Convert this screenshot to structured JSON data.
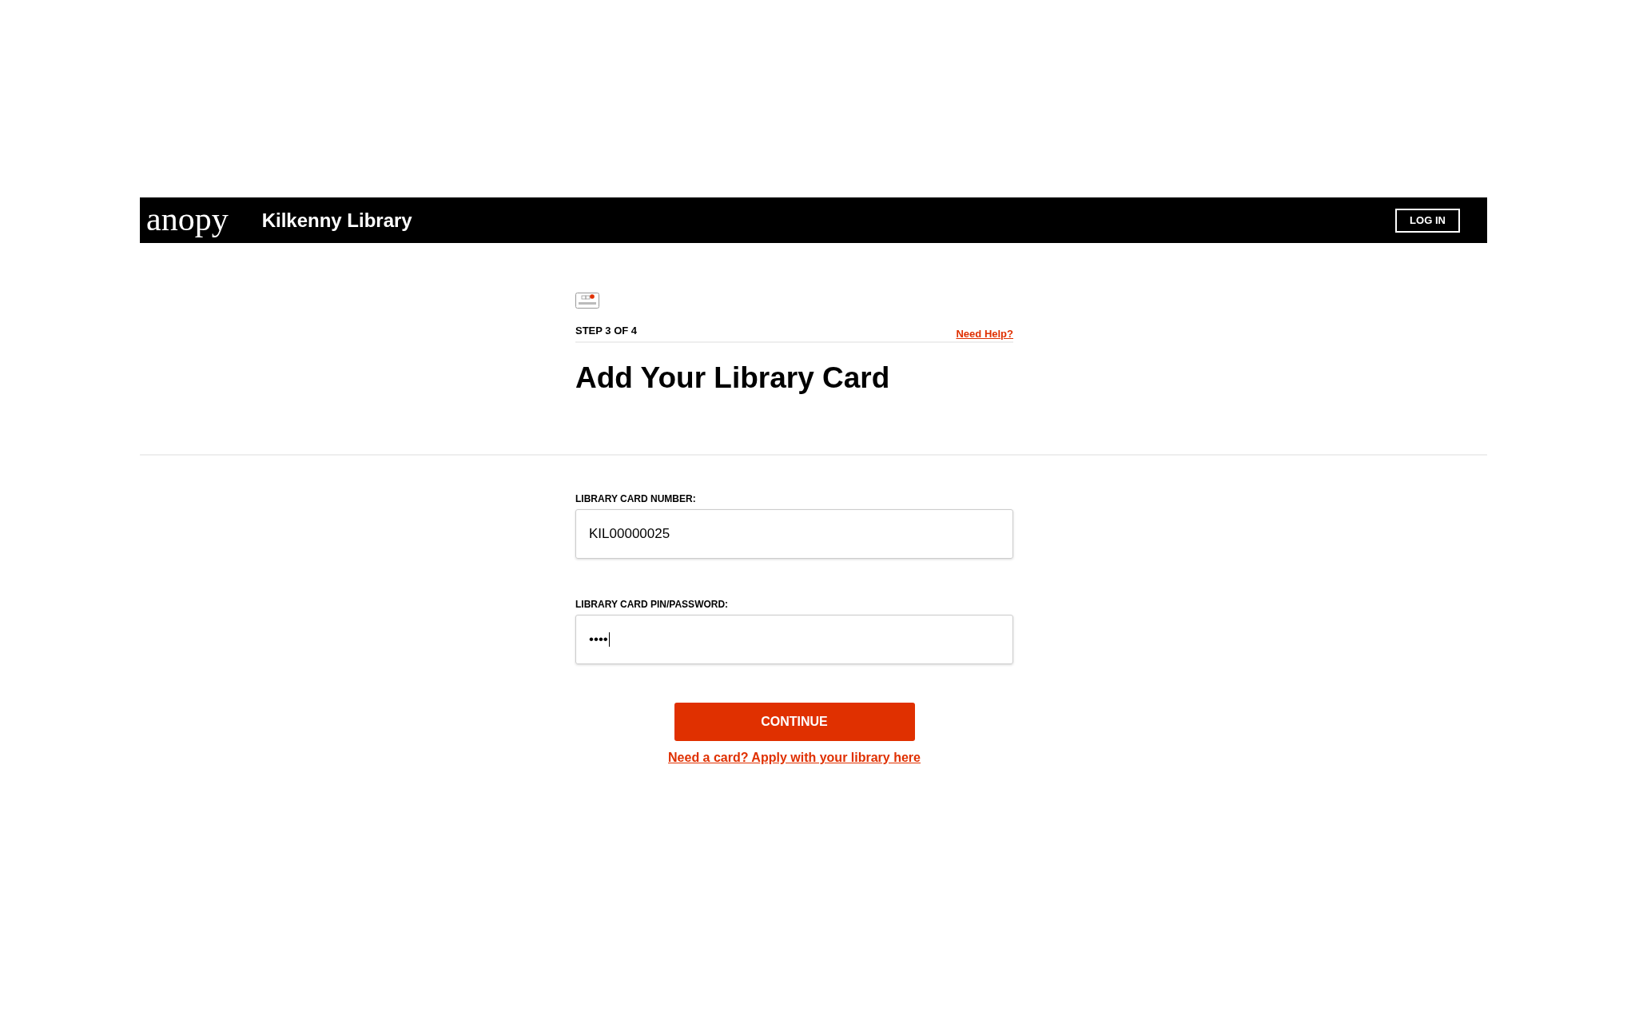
{
  "header": {
    "logo": "anopy",
    "library_name": "Kilkenny Library",
    "login_button": "LOG IN"
  },
  "step": {
    "label": "STEP 3 OF 4",
    "help_link": "Need Help?",
    "title": "Add Your Library Card"
  },
  "fields": [
    {
      "label": "LIBRARY CARD NUMBER:",
      "value": "KIL00000025",
      "focused": false
    },
    {
      "label": "LIBRARY CARD PIN/PASSWORD:",
      "value": "••••",
      "focused": true
    }
  ],
  "continue_button": "CONTINUE",
  "apply_link": "Need a card? Apply with your library here"
}
